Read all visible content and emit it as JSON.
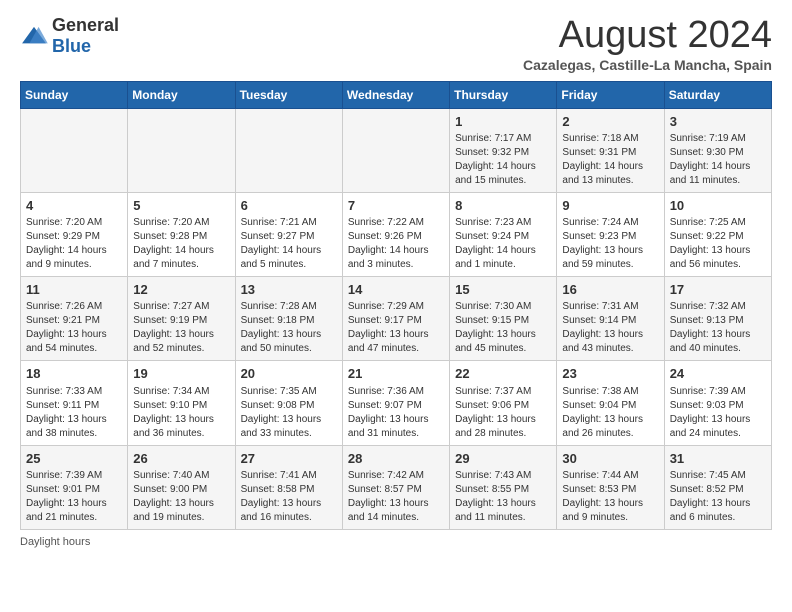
{
  "header": {
    "logo_general": "General",
    "logo_blue": "Blue",
    "month_year": "August 2024",
    "location": "Cazalegas, Castille-La Mancha, Spain"
  },
  "days_of_week": [
    "Sunday",
    "Monday",
    "Tuesday",
    "Wednesday",
    "Thursday",
    "Friday",
    "Saturday"
  ],
  "weeks": [
    [
      {
        "day": "",
        "info": ""
      },
      {
        "day": "",
        "info": ""
      },
      {
        "day": "",
        "info": ""
      },
      {
        "day": "",
        "info": ""
      },
      {
        "day": "1",
        "info": "Sunrise: 7:17 AM\nSunset: 9:32 PM\nDaylight: 14 hours and 15 minutes."
      },
      {
        "day": "2",
        "info": "Sunrise: 7:18 AM\nSunset: 9:31 PM\nDaylight: 14 hours and 13 minutes."
      },
      {
        "day": "3",
        "info": "Sunrise: 7:19 AM\nSunset: 9:30 PM\nDaylight: 14 hours and 11 minutes."
      }
    ],
    [
      {
        "day": "4",
        "info": "Sunrise: 7:20 AM\nSunset: 9:29 PM\nDaylight: 14 hours and 9 minutes."
      },
      {
        "day": "5",
        "info": "Sunrise: 7:20 AM\nSunset: 9:28 PM\nDaylight: 14 hours and 7 minutes."
      },
      {
        "day": "6",
        "info": "Sunrise: 7:21 AM\nSunset: 9:27 PM\nDaylight: 14 hours and 5 minutes."
      },
      {
        "day": "7",
        "info": "Sunrise: 7:22 AM\nSunset: 9:26 PM\nDaylight: 14 hours and 3 minutes."
      },
      {
        "day": "8",
        "info": "Sunrise: 7:23 AM\nSunset: 9:24 PM\nDaylight: 14 hours and 1 minute."
      },
      {
        "day": "9",
        "info": "Sunrise: 7:24 AM\nSunset: 9:23 PM\nDaylight: 13 hours and 59 minutes."
      },
      {
        "day": "10",
        "info": "Sunrise: 7:25 AM\nSunset: 9:22 PM\nDaylight: 13 hours and 56 minutes."
      }
    ],
    [
      {
        "day": "11",
        "info": "Sunrise: 7:26 AM\nSunset: 9:21 PM\nDaylight: 13 hours and 54 minutes."
      },
      {
        "day": "12",
        "info": "Sunrise: 7:27 AM\nSunset: 9:19 PM\nDaylight: 13 hours and 52 minutes."
      },
      {
        "day": "13",
        "info": "Sunrise: 7:28 AM\nSunset: 9:18 PM\nDaylight: 13 hours and 50 minutes."
      },
      {
        "day": "14",
        "info": "Sunrise: 7:29 AM\nSunset: 9:17 PM\nDaylight: 13 hours and 47 minutes."
      },
      {
        "day": "15",
        "info": "Sunrise: 7:30 AM\nSunset: 9:15 PM\nDaylight: 13 hours and 45 minutes."
      },
      {
        "day": "16",
        "info": "Sunrise: 7:31 AM\nSunset: 9:14 PM\nDaylight: 13 hours and 43 minutes."
      },
      {
        "day": "17",
        "info": "Sunrise: 7:32 AM\nSunset: 9:13 PM\nDaylight: 13 hours and 40 minutes."
      }
    ],
    [
      {
        "day": "18",
        "info": "Sunrise: 7:33 AM\nSunset: 9:11 PM\nDaylight: 13 hours and 38 minutes."
      },
      {
        "day": "19",
        "info": "Sunrise: 7:34 AM\nSunset: 9:10 PM\nDaylight: 13 hours and 36 minutes."
      },
      {
        "day": "20",
        "info": "Sunrise: 7:35 AM\nSunset: 9:08 PM\nDaylight: 13 hours and 33 minutes."
      },
      {
        "day": "21",
        "info": "Sunrise: 7:36 AM\nSunset: 9:07 PM\nDaylight: 13 hours and 31 minutes."
      },
      {
        "day": "22",
        "info": "Sunrise: 7:37 AM\nSunset: 9:06 PM\nDaylight: 13 hours and 28 minutes."
      },
      {
        "day": "23",
        "info": "Sunrise: 7:38 AM\nSunset: 9:04 PM\nDaylight: 13 hours and 26 minutes."
      },
      {
        "day": "24",
        "info": "Sunrise: 7:39 AM\nSunset: 9:03 PM\nDaylight: 13 hours and 24 minutes."
      }
    ],
    [
      {
        "day": "25",
        "info": "Sunrise: 7:39 AM\nSunset: 9:01 PM\nDaylight: 13 hours and 21 minutes."
      },
      {
        "day": "26",
        "info": "Sunrise: 7:40 AM\nSunset: 9:00 PM\nDaylight: 13 hours and 19 minutes."
      },
      {
        "day": "27",
        "info": "Sunrise: 7:41 AM\nSunset: 8:58 PM\nDaylight: 13 hours and 16 minutes."
      },
      {
        "day": "28",
        "info": "Sunrise: 7:42 AM\nSunset: 8:57 PM\nDaylight: 13 hours and 14 minutes."
      },
      {
        "day": "29",
        "info": "Sunrise: 7:43 AM\nSunset: 8:55 PM\nDaylight: 13 hours and 11 minutes."
      },
      {
        "day": "30",
        "info": "Sunrise: 7:44 AM\nSunset: 8:53 PM\nDaylight: 13 hours and 9 minutes."
      },
      {
        "day": "31",
        "info": "Sunrise: 7:45 AM\nSunset: 8:52 PM\nDaylight: 13 hours and 6 minutes."
      }
    ]
  ],
  "footer": {
    "daylight_label": "Daylight hours"
  }
}
